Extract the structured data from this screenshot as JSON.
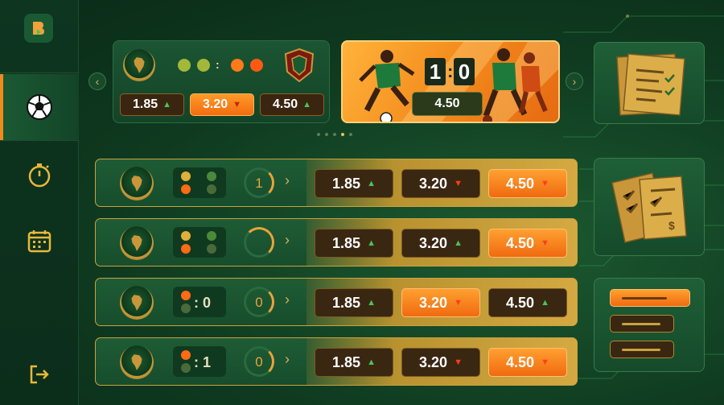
{
  "sidebar": {
    "items": [
      {
        "icon": "soccer-ball-icon",
        "active": true
      },
      {
        "icon": "stopwatch-icon",
        "active": false
      },
      {
        "icon": "calendar-icon",
        "active": false
      }
    ],
    "logout_icon": "logout-icon",
    "logo_icon": "brand-logo-icon"
  },
  "featured": {
    "odds": [
      {
        "value": "1.85",
        "trend": "up",
        "style": "dark"
      },
      {
        "value": "3.20",
        "trend": "down",
        "style": "hot"
      },
      {
        "value": "4.50",
        "trend": "up",
        "style": "dark"
      }
    ],
    "dots": [
      "#a3b83a",
      "#a3b83a",
      "#ff7a1a",
      "#ff5a14"
    ]
  },
  "hero": {
    "score_home": "1",
    "score_away": "0",
    "odd": "4.50"
  },
  "pager": {
    "count": 5,
    "active": 3
  },
  "rows": [
    {
      "status_dots": [
        "#e0b03a",
        "#4a8a3a",
        "#ff6a14",
        "#4a6a3a"
      ],
      "score": "",
      "timer": "1",
      "odds": [
        {
          "value": "1.85",
          "trend": "up",
          "style": "dark"
        },
        {
          "value": "3.20",
          "trend": "down",
          "style": "dark"
        },
        {
          "value": "4.50",
          "trend": "down",
          "style": "hot"
        }
      ]
    },
    {
      "status_dots": [
        "#e0b03a",
        "#4a8a3a",
        "#ff6a14",
        "#4a6a3a"
      ],
      "score": "",
      "timer": "",
      "odds": [
        {
          "value": "1.85",
          "trend": "up",
          "style": "dark"
        },
        {
          "value": "3.20",
          "trend": "up",
          "style": "dark"
        },
        {
          "value": "4.50",
          "trend": "down",
          "style": "hot"
        }
      ]
    },
    {
      "status_dots": [
        "#ff6a14",
        "#4a6a3a"
      ],
      "score": "0",
      "timer": "0",
      "odds": [
        {
          "value": "1.85",
          "trend": "up",
          "style": "dark"
        },
        {
          "value": "3.20",
          "trend": "down",
          "style": "hot"
        },
        {
          "value": "4.50",
          "trend": "up",
          "style": "dark"
        }
      ]
    },
    {
      "status_dots": [
        "#ff6a14",
        "#4a6a3a"
      ],
      "score": "1",
      "timer": "0",
      "odds": [
        {
          "value": "1.85",
          "trend": "up",
          "style": "dark"
        },
        {
          "value": "3.20",
          "trend": "down",
          "style": "dark"
        },
        {
          "value": "4.50",
          "trend": "down",
          "style": "hot"
        }
      ]
    }
  ],
  "right_panel": {
    "tiles": [
      "bet-slip-icon",
      "tickets-icon",
      "menu-list-icon"
    ]
  },
  "colors": {
    "accent": "#f26c10",
    "gold": "#c9a23e",
    "up": "#4ac35a",
    "down": "#ff3e1a"
  }
}
